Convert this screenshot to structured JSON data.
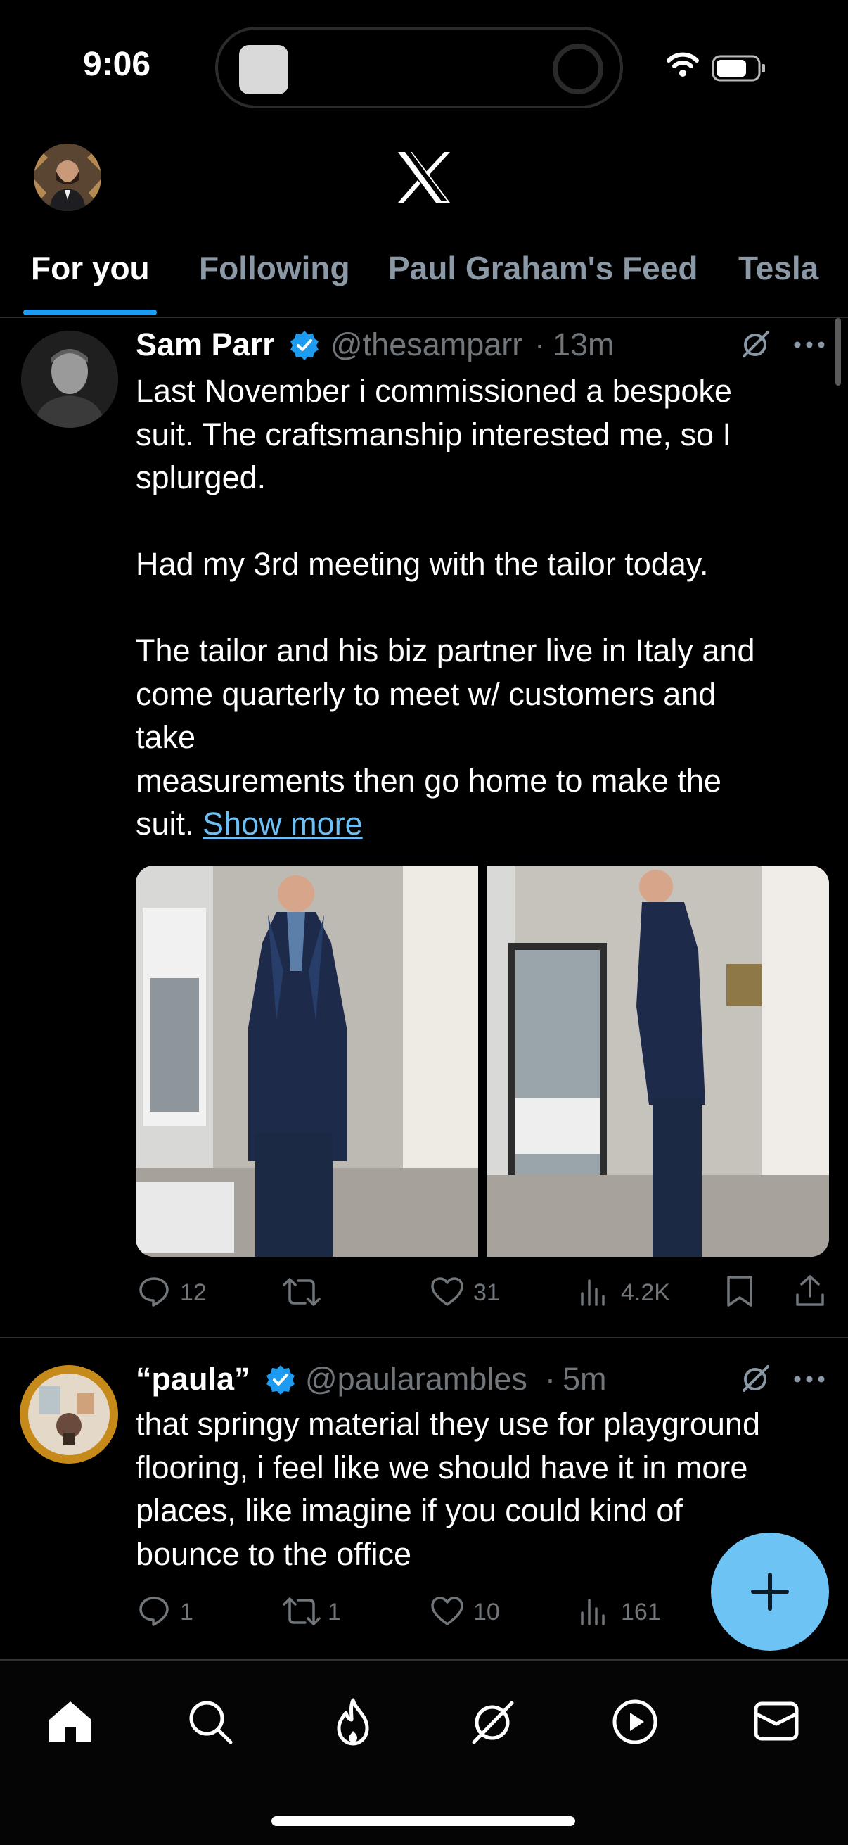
{
  "status_bar": {
    "time": "9:06"
  },
  "header": {
    "tabs": [
      {
        "label": "For you",
        "active": true
      },
      {
        "label": "Following"
      },
      {
        "label": "Paul Graham's Feed"
      },
      {
        "label": "Tesla"
      }
    ]
  },
  "posts": [
    {
      "name": "Sam Parr",
      "verified": true,
      "handle": "@thesamparr",
      "time": "13m",
      "text": "Last November i commissioned a bespoke\nsuit. The craftsmanship interested me, so I\nsplurged.\n\nHad my 3rd meeting with the tailor today.\n\nThe tailor and his biz partner live in Italy and\ncome quarterly to meet w/ customers and\ntake\nmeasurements then go home to make the\nsuit.",
      "show_more": "Show more",
      "stats": {
        "replies": "12",
        "likes": "31",
        "views": "4.2K"
      }
    },
    {
      "name": "“paula”",
      "verified": true,
      "handle": "@paularambles",
      "time": "5m",
      "text": "that springy material they use for playground\nflooring, i feel like we should have it in more\nplaces, like imagine if you could kind of\nbounce to the office",
      "stats": {
        "replies": "1",
        "reposts": "1",
        "likes": "10",
        "views": "161"
      }
    }
  ],
  "colors": {
    "accent": "#1d9bf0",
    "compose": "#6ec3f5",
    "link": "#6cc0f5",
    "muted": "#71767b"
  },
  "icons": [
    "x-logo",
    "verified-badge-icon",
    "grok-icon",
    "more-icon",
    "reply-icon",
    "repost-icon",
    "like-icon",
    "views-icon",
    "bookmark-icon",
    "share-icon",
    "plus-icon",
    "home-icon",
    "search-icon",
    "flame-icon",
    "play-icon",
    "mail-icon",
    "wifi-icon",
    "battery-icon"
  ]
}
